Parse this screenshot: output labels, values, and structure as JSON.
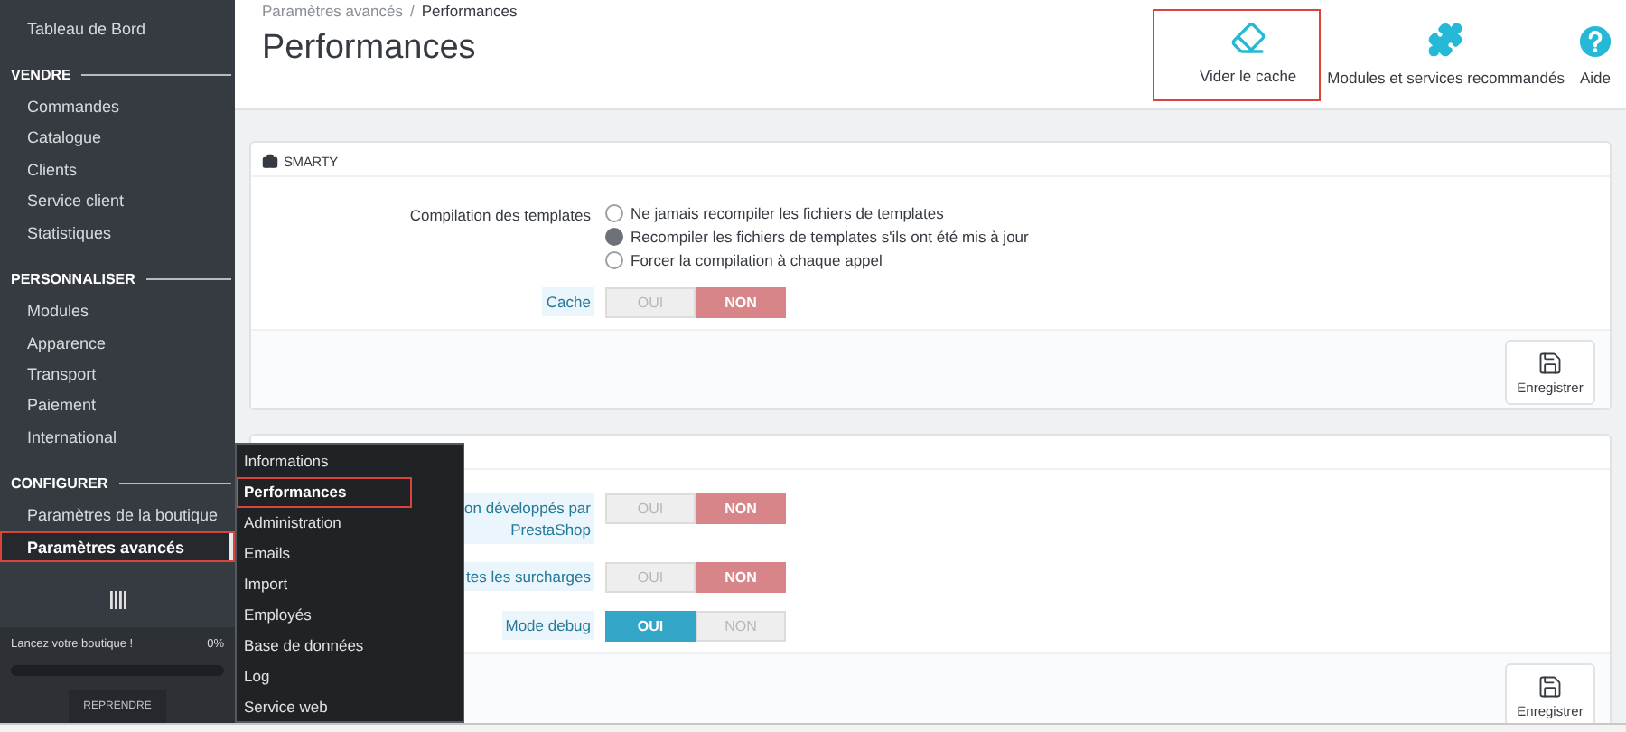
{
  "sidebar": {
    "top_item": {
      "label": "Tableau de Bord",
      "selected": false
    },
    "sections": [
      {
        "heading": "VENDRE",
        "items": [
          {
            "label": "Commandes",
            "selected": false
          },
          {
            "label": "Catalogue",
            "selected": false
          },
          {
            "label": "Clients",
            "selected": false
          },
          {
            "label": "Service client",
            "selected": false
          },
          {
            "label": "Statistiques",
            "selected": false
          }
        ]
      },
      {
        "heading": "PERSONNALISER",
        "items": [
          {
            "label": "Modules",
            "selected": false
          },
          {
            "label": "Apparence",
            "selected": false
          },
          {
            "label": "Transport",
            "selected": false
          },
          {
            "label": "Paiement",
            "selected": false
          },
          {
            "label": "International",
            "selected": false
          }
        ]
      },
      {
        "heading": "CONFIGURER",
        "items": [
          {
            "label": "Paramètres de la boutique",
            "selected": false,
            "highlighted": false
          },
          {
            "label": "Paramètres avancés",
            "selected": true,
            "highlighted": true
          }
        ]
      }
    ],
    "onboarding": {
      "label": "Lancez votre boutique !",
      "percent": "0%",
      "level": 0,
      "button": "REPRENDRE"
    }
  },
  "submenu": [
    {
      "label": "Informations",
      "selected": false,
      "highlighted": false
    },
    {
      "label": "Performances",
      "selected": true,
      "highlighted": true
    },
    {
      "label": "Administration",
      "selected": false,
      "highlighted": false
    },
    {
      "label": "Emails",
      "selected": false,
      "highlighted": false
    },
    {
      "label": "Import",
      "selected": false,
      "highlighted": false
    },
    {
      "label": "Employés",
      "selected": false,
      "highlighted": false
    },
    {
      "label": "Base de données",
      "selected": false,
      "highlighted": false
    },
    {
      "label": "Log",
      "selected": false,
      "highlighted": false
    },
    {
      "label": "Service web",
      "selected": false,
      "highlighted": false
    }
  ],
  "breadcrumb": {
    "items": [
      "Paramètres avancés",
      "Performances"
    ],
    "separator": "/"
  },
  "page_title": "Performances",
  "toolbar": [
    {
      "kind": "eraser",
      "label": "Vider le cache",
      "highlighted": true
    },
    {
      "kind": "puzzle",
      "label": "Modules et services recommandés",
      "highlighted": false
    },
    {
      "kind": "help",
      "label": "Aide",
      "highlighted": false
    }
  ],
  "panels": [
    {
      "title": "SMARTY",
      "rows": [
        {
          "kind": "radio",
          "label": [
            "Compilation des templates"
          ],
          "help": false,
          "options": [
            {
              "label": "Ne jamais recompiler les fichiers de templates",
              "selected": false
            },
            {
              "label": "Recompiler les fichiers de templates s'ils ont été mis à jour",
              "selected": true
            },
            {
              "label": "Forcer la compilation à chaque appel",
              "selected": false
            }
          ]
        },
        {
          "kind": "toggle",
          "label": [
            "Cache"
          ],
          "help": true,
          "options": [
            {
              "label": "OUI",
              "selected": false
            },
            {
              "label": "NON",
              "selected": true
            }
          ]
        }
      ],
      "save": "Enregistrer"
    },
    {
      "rows": [
        {
          "kind": "toggle",
          "label": [
            "on développés par",
            "PrestaShop"
          ],
          "help": true,
          "options": [
            {
              "label": "OUI",
              "selected": false
            },
            {
              "label": "NON",
              "selected": true
            }
          ]
        },
        {
          "kind": "toggle",
          "label": [
            "tes les surcharges"
          ],
          "help": true,
          "options": [
            {
              "label": "OUI",
              "selected": false
            },
            {
              "label": "NON",
              "selected": true
            }
          ]
        },
        {
          "kind": "toggle",
          "label": [
            "Mode debug"
          ],
          "help": true,
          "options": [
            {
              "label": "OUI",
              "selected": true
            },
            {
              "label": "NON",
              "selected": false
            }
          ]
        }
      ],
      "save": "Enregistrer"
    }
  ]
}
